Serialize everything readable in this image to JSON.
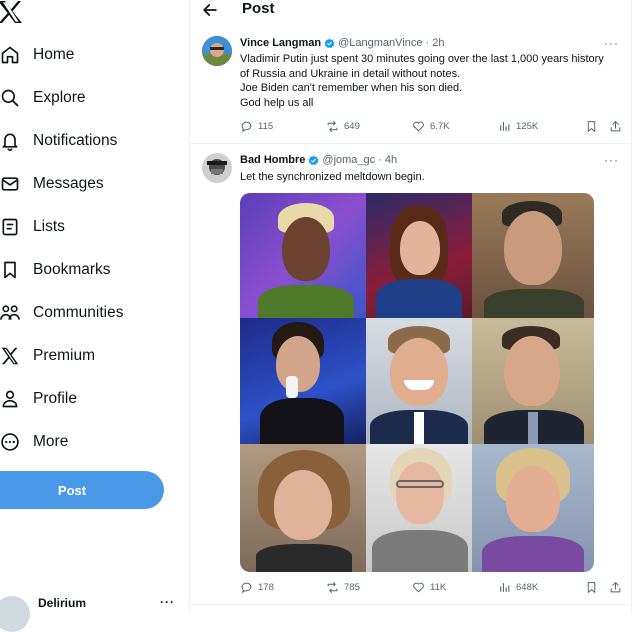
{
  "sidebar": {
    "items": [
      {
        "label": "Home",
        "icon": "home-icon"
      },
      {
        "label": "Explore",
        "icon": "search-icon"
      },
      {
        "label": "Notifications",
        "icon": "bell-icon"
      },
      {
        "label": "Messages",
        "icon": "envelope-icon"
      },
      {
        "label": "Lists",
        "icon": "list-icon"
      },
      {
        "label": "Bookmarks",
        "icon": "bookmark-icon"
      },
      {
        "label": "Communities",
        "icon": "people-icon"
      },
      {
        "label": "Premium",
        "icon": "x-logo-icon"
      },
      {
        "label": "Profile",
        "icon": "person-icon"
      },
      {
        "label": "More",
        "icon": "more-circle-icon"
      }
    ],
    "post_label": "Post",
    "account_name": "Delirium",
    "account_more": "···"
  },
  "header": {
    "title": "Post"
  },
  "tweets": [
    {
      "name": "Vince Langman",
      "handle": "@LangmanVince · 2h",
      "lines": [
        "Vladimir Putin just spent 30 minutes going over the last 1,000 years history",
        "of Russia and Ukraine in detail without notes.",
        "Joe Biden can't remember when his son died.",
        "God help us all"
      ],
      "replies": "115",
      "reposts": "649",
      "likes": "6.7K",
      "views": "125K",
      "more": "···"
    },
    {
      "name": "Bad Hombre",
      "handle": "@joma_gc · 4h",
      "lines": [
        "Let the synchronized meltdown begin."
      ],
      "replies": "178",
      "reposts": "785",
      "likes": "11K",
      "views": "648K",
      "more": "···"
    }
  ],
  "colors": {
    "accent": "#1d9bf0",
    "post_button": "#4a99e9",
    "secondary_text": "#536471",
    "divider": "#eff3f4"
  }
}
